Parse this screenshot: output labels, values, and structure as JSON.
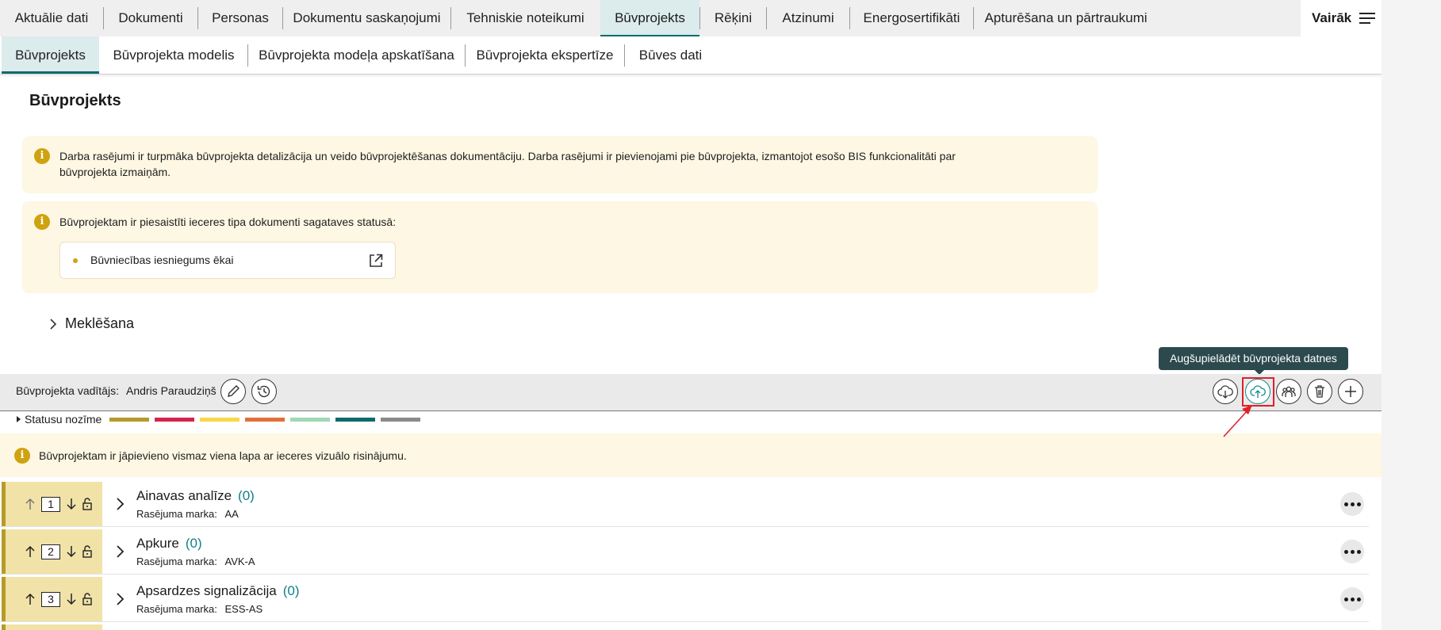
{
  "top_tabs": [
    {
      "label": "Aktuālie dati"
    },
    {
      "label": "Dokumenti"
    },
    {
      "label": "Personas"
    },
    {
      "label": "Dokumentu saskaņojumi"
    },
    {
      "label": "Tehniskie noteikumi"
    },
    {
      "label": "Būvprojekts",
      "active": true
    },
    {
      "label": "Rēķini"
    },
    {
      "label": "Atzinumi"
    },
    {
      "label": "Energosertifikāti"
    },
    {
      "label": "Apturēšana un pārtraukumi"
    }
  ],
  "more_label": "Vairāk",
  "sub_tabs": [
    {
      "label": "Būvprojekts",
      "active": true
    },
    {
      "label": "Būvprojekta modelis"
    },
    {
      "label": "Būvprojekta modeļa apskatīšana"
    },
    {
      "label": "Būvprojekta ekspertīze"
    },
    {
      "label": "Būves dati"
    }
  ],
  "page_title": "Būvprojekts",
  "notice1": {
    "line1": "Darba rasējumi ir turpmāka būvprojekta detalizācija un veido būvprojektēšanas dokumentāciju. Darba rasējumi ir pievienojami pie būvprojekta, izmantojot esošo BIS funkcionalitāti par",
    "line2": "būvprojekta izmaiņām."
  },
  "notice2": {
    "text": "Būvprojektam ir piesaistīti ieceres tipa dokumenti sagataves statusā:",
    "link_label": "Būvniecības iesniegums ēkai"
  },
  "search_label": "Meklēšana",
  "toolbar": {
    "manager_label": "Būvprojekta vadītājs:",
    "manager_name": "Andris Paraudziņš",
    "tooltip": "Augšupielādēt būvprojekta datnes"
  },
  "status_legend": {
    "label": "Statusu nozīme",
    "colors": [
      "#b49a2c",
      "#d6234e",
      "#f6d94a",
      "#e0703a",
      "#9fd9b3",
      "#0e6a6c",
      "#8a8a8a"
    ]
  },
  "warning_text": "Būvprojektam ir jāpievieno vismaz viena lapa ar ieceres vizuālo risinājumu.",
  "sections": [
    {
      "order": "1",
      "title": "Ainavas analīze",
      "count": "(0)",
      "mark_label": "Rasējuma marka:",
      "mark": "AA"
    },
    {
      "order": "2",
      "title": "Apkure",
      "count": "(0)",
      "mark_label": "Rasējuma marka:",
      "mark": "AVK-A"
    },
    {
      "order": "3",
      "title": "Apsardzes signalizācija",
      "count": "(0)",
      "mark_label": "Rasējuma marka:",
      "mark": "ESS-AS"
    }
  ],
  "icons": {
    "info": "info-icon",
    "menu": "hamburger-icon",
    "external": "external-link-icon",
    "edit": "pencil-icon",
    "history": "history-icon",
    "download": "cloud-download-icon",
    "upload": "cloud-upload-icon",
    "group": "users-icon",
    "delete": "trash-icon",
    "add": "plus-icon"
  }
}
